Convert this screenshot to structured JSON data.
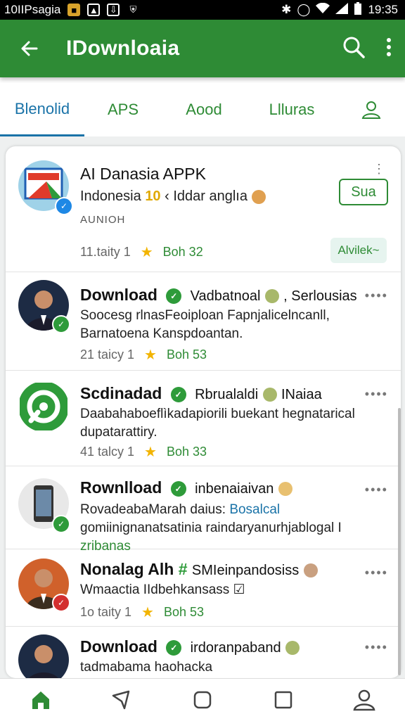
{
  "status_bar": {
    "carrier": "10IIPsagia",
    "time": "19:35"
  },
  "app_bar": {
    "title": "IDownloaia"
  },
  "tabs": [
    {
      "label": "Blenolid"
    },
    {
      "label": "APS"
    },
    {
      "label": "Aood"
    },
    {
      "label": "Llluras"
    }
  ],
  "featured": {
    "title": "AI Danasia APPK",
    "subtitle": "Indonesia",
    "subtitle_num": "10",
    "subtitle_rest": "‹ Iddar anglıa",
    "section_label": "AUNIOH",
    "meta_count": "11.taity 1",
    "meta_rating": "Boh 32",
    "button_label": "Sua",
    "button2_label": "Alvilek~"
  },
  "items": [
    {
      "title": "Download",
      "extra": "Vadbatnoal",
      "extra2": ", Serlousias",
      "desc": "Soocesg rlnasFeoiploan Fapnjalicelncanll, Barnatoena Kanspdoantan.",
      "meta_count": "21 taicy 1",
      "meta_rating": "Boh 53"
    },
    {
      "title": "Scdinadad",
      "extra": "Rbrualaldi",
      "extra2": "INaiaa",
      "desc": "Daabahaboeflìkadapiorili buekant hegnatarical dupatarattiry.",
      "meta_count": "41 talcy 1",
      "meta_rating": "Boh 33"
    },
    {
      "title": "Rownlload",
      "extra": "inbenaiaivan",
      "desc_a": "RovadeabaMarah daius:",
      "desc_b": "Bosalcal",
      "desc_c": "gomiinignanatsatinia raindaryanurhjablogal I",
      "desc_d": "zribanas"
    },
    {
      "title": "Nonalag Alh",
      "extra": "SMIeinpandosiss",
      "desc": "Wmaactia IIdbehkansass",
      "meta_count": "1o taity 1",
      "meta_rating": "Boh 53"
    },
    {
      "title": "Download",
      "extra": "irdoranpaband",
      "desc": "tadmabama haohacka"
    }
  ],
  "colors": {
    "brand_green": "#2e8b35",
    "tab_active": "#1a73a8",
    "star": "#f2b400"
  }
}
